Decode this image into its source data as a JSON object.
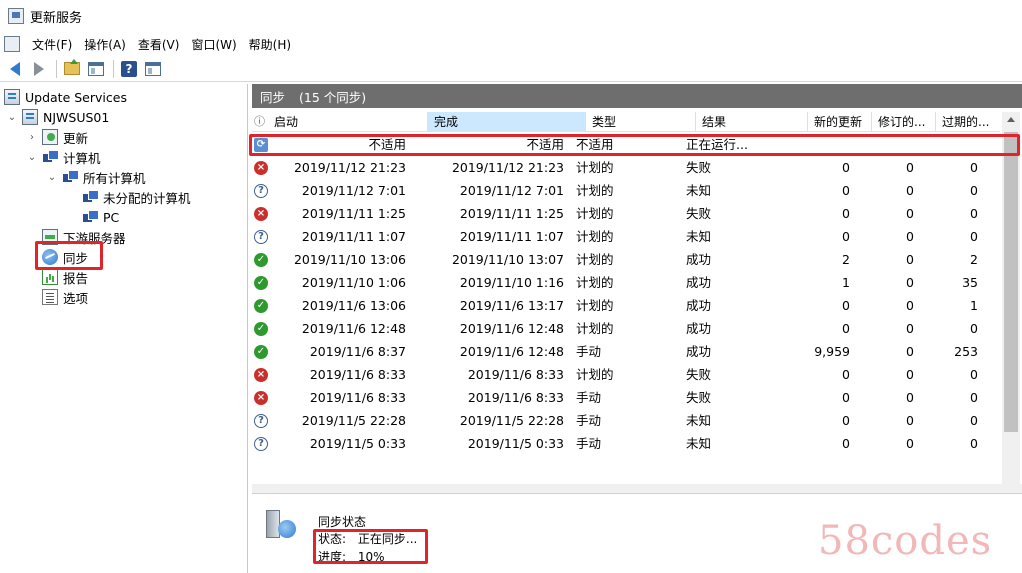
{
  "window": {
    "title": "更新服务"
  },
  "menu": [
    "文件(F)",
    "操作(A)",
    "查看(V)",
    "窗口(W)",
    "帮助(H)"
  ],
  "tree": {
    "root": "Update Services",
    "server": "NJWSUS01",
    "updates": "更新",
    "computers": "计算机",
    "all_computers": "所有计算机",
    "unassigned": "未分配的计算机",
    "pc": "PC",
    "downstream": "下游服务器",
    "sync": "同步",
    "reports": "报告",
    "options": "选项"
  },
  "panel": {
    "title": "同步",
    "count": "(15 个同步)"
  },
  "columns": [
    "启动",
    "完成",
    "类型",
    "结果",
    "新的更新",
    "修订的...",
    "过期的..."
  ],
  "rows": [
    {
      "status": "running",
      "start": "不适用",
      "end": "不适用",
      "type": "不适用",
      "result": "正在运行...",
      "new": "",
      "revised": "",
      "expired": ""
    },
    {
      "status": "fail",
      "start": "2019/11/12 21:23",
      "end": "2019/11/12 21:23",
      "type": "计划的",
      "result": "失败",
      "new": "0",
      "revised": "0",
      "expired": "0"
    },
    {
      "status": "unknown",
      "start": "2019/11/12 7:01",
      "end": "2019/11/12 7:01",
      "type": "计划的",
      "result": "未知",
      "new": "0",
      "revised": "0",
      "expired": "0"
    },
    {
      "status": "fail",
      "start": "2019/11/11 1:25",
      "end": "2019/11/11 1:25",
      "type": "计划的",
      "result": "失败",
      "new": "0",
      "revised": "0",
      "expired": "0"
    },
    {
      "status": "unknown",
      "start": "2019/11/11 1:07",
      "end": "2019/11/11 1:07",
      "type": "计划的",
      "result": "未知",
      "new": "0",
      "revised": "0",
      "expired": "0"
    },
    {
      "status": "ok",
      "start": "2019/11/10 13:06",
      "end": "2019/11/10 13:07",
      "type": "计划的",
      "result": "成功",
      "new": "2",
      "revised": "0",
      "expired": "2"
    },
    {
      "status": "ok",
      "start": "2019/11/10 1:06",
      "end": "2019/11/10 1:16",
      "type": "计划的",
      "result": "成功",
      "new": "1",
      "revised": "0",
      "expired": "35"
    },
    {
      "status": "ok",
      "start": "2019/11/6 13:06",
      "end": "2019/11/6 13:17",
      "type": "计划的",
      "result": "成功",
      "new": "0",
      "revised": "0",
      "expired": "1"
    },
    {
      "status": "ok",
      "start": "2019/11/6 12:48",
      "end": "2019/11/6 12:48",
      "type": "计划的",
      "result": "成功",
      "new": "0",
      "revised": "0",
      "expired": "0"
    },
    {
      "status": "ok",
      "start": "2019/11/6 8:37",
      "end": "2019/11/6 12:48",
      "type": "手动",
      "result": "成功",
      "new": "9,959",
      "revised": "0",
      "expired": "253"
    },
    {
      "status": "fail",
      "start": "2019/11/6 8:33",
      "end": "2019/11/6 8:33",
      "type": "计划的",
      "result": "失败",
      "new": "0",
      "revised": "0",
      "expired": "0"
    },
    {
      "status": "fail",
      "start": "2019/11/6 8:33",
      "end": "2019/11/6 8:33",
      "type": "手动",
      "result": "失败",
      "new": "0",
      "revised": "0",
      "expired": "0"
    },
    {
      "status": "unknown",
      "start": "2019/11/5 22:28",
      "end": "2019/11/5 22:28",
      "type": "手动",
      "result": "未知",
      "new": "0",
      "revised": "0",
      "expired": "0"
    },
    {
      "status": "unknown",
      "start": "2019/11/5 0:33",
      "end": "2019/11/5 0:33",
      "type": "手动",
      "result": "未知",
      "new": "0",
      "revised": "0",
      "expired": "0"
    }
  ],
  "details": {
    "heading": "同步状态",
    "status_label": "状态:",
    "status_value": "正在同步...",
    "progress_label": "进度:",
    "progress_value": "10%"
  },
  "watermark": "58codes",
  "colors": {
    "highlight": "#e0242b",
    "header_bg": "#6e6e6e",
    "sorted_col": "#cce8ff"
  }
}
